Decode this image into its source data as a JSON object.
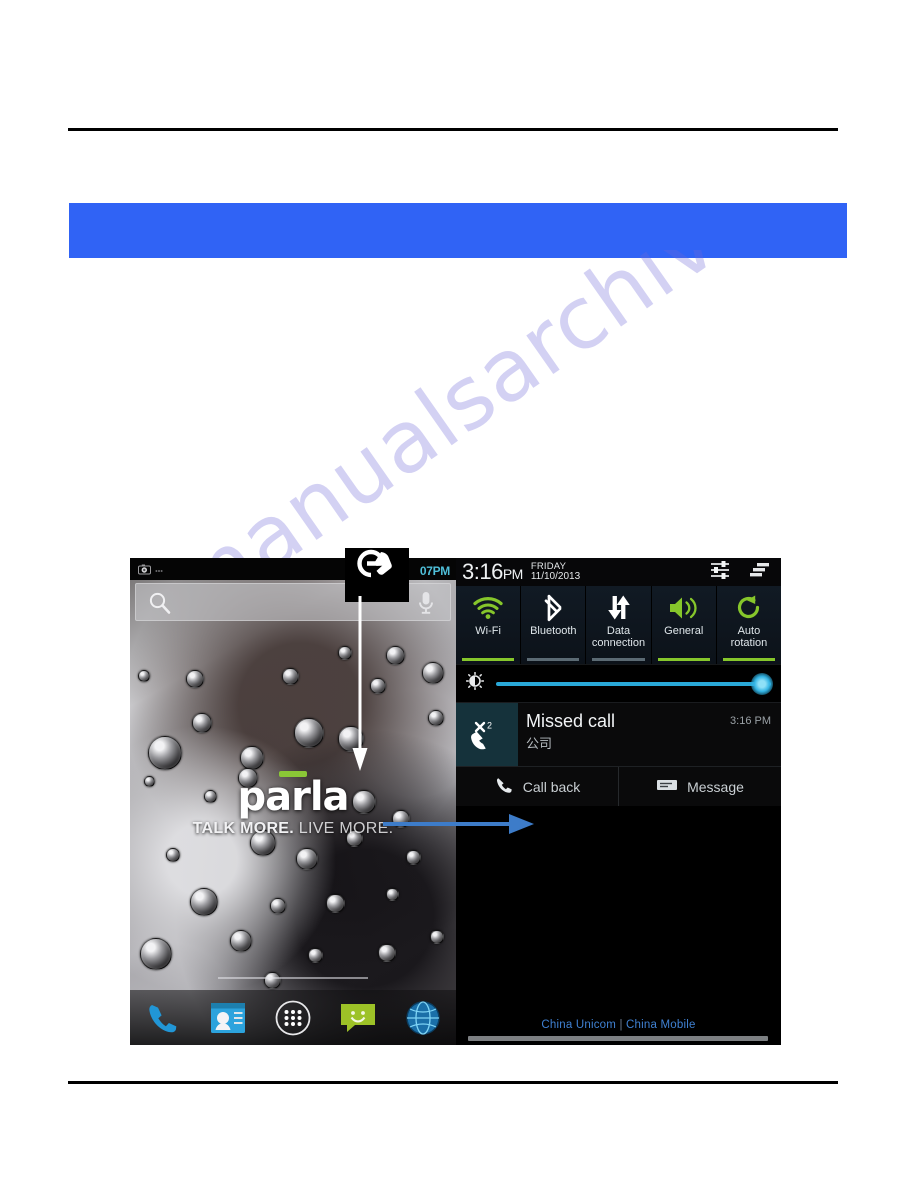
{
  "document": {
    "banner_text": "",
    "watermark": "manualsarchive.com"
  },
  "phone_left": {
    "name": "home-screen",
    "status_bar": {
      "time": "07PM",
      "icons": [
        "camera-icon",
        "mute-icon"
      ]
    },
    "search_widget": {
      "placeholder": "",
      "search_icon": "magnifier-icon",
      "voice_icon": "microphone-icon"
    },
    "wallpaper_branding": {
      "logo": "parla",
      "tagline_part1": "TALK MORE.",
      "tagline_part2": "LIVE MORE.",
      "accent_color": "#8ac736"
    },
    "dock": [
      {
        "label": "Phone",
        "icon": "phone-handset-icon"
      },
      {
        "label": "Contacts",
        "icon": "contacts-icon"
      },
      {
        "label": "Apps",
        "icon": "app-drawer-icon"
      },
      {
        "label": "Messaging",
        "icon": "message-bubble-icon"
      },
      {
        "label": "Browser",
        "icon": "globe-browser-icon"
      }
    ]
  },
  "phone_right": {
    "name": "notification-shade",
    "header": {
      "clock_time": "3:16",
      "clock_meridiem": "PM",
      "day": "FRIDAY",
      "date": "11/10/2013",
      "settings_icon": "settings-sliders-icon",
      "clear_all_icon": "clear-all-notifications-icon"
    },
    "quick_settings": [
      {
        "label": "Wi-Fi",
        "icon": "wifi-icon",
        "state": "on",
        "color": "#86c62b"
      },
      {
        "label": "Bluetooth",
        "icon": "bluetooth-icon",
        "state": "off",
        "color": "#ffffff"
      },
      {
        "label": "Data connection",
        "icon": "data-transfer-icon",
        "state": "off",
        "color": "#ffffff"
      },
      {
        "label": "General",
        "icon": "speaker-volume-icon",
        "state": "on",
        "color": "#86c62b"
      },
      {
        "label": "Auto rotation",
        "icon": "auto-rotate-icon",
        "state": "on",
        "color": "#86c62b"
      }
    ],
    "brightness": {
      "icon": "brightness-icon",
      "value": 100,
      "track_color": "#29a8d8"
    },
    "notification": {
      "icon": "missed-call-icon",
      "badge_count": "2",
      "title": "Missed call",
      "subtitle": "公司",
      "time": "3:16 PM",
      "actions": [
        {
          "label": "Call back",
          "icon": "phone-handset-icon"
        },
        {
          "label": "Message",
          "icon": "message-lines-icon"
        }
      ]
    },
    "carrier": {
      "sim1": "China Unicom",
      "separator": "|",
      "sim2": "China Mobile",
      "color": "#3f80d1"
    }
  },
  "annotations": {
    "gesture_icon": "swipe-down-hand-icon",
    "arrow_down": "white-down-arrow",
    "arrow_right": "blue-right-arrow",
    "arrow_right_color": "#3d7cc9"
  }
}
